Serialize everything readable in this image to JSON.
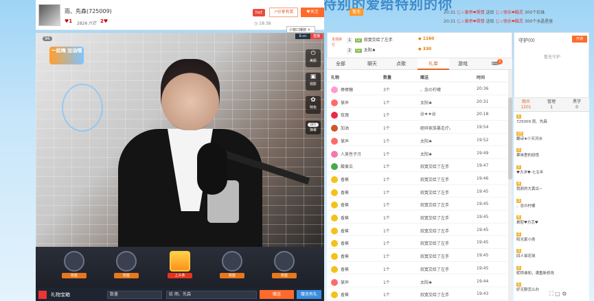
{
  "banner": "待别的爱给特别的你",
  "anchor": {
    "name": "雨、先森(725009)",
    "level_a": "1",
    "fans": "2826 六芒",
    "level_b": "2",
    "hot": "hot",
    "share": "分享有奖",
    "follow": "关注",
    "time_info": "18:38",
    "popup_tip": "小窗口播放",
    "logo_a": "6.cn",
    "logo_b": "直播",
    "rank_tag": "暂无"
  },
  "video": {
    "viewers": "96",
    "deco_text": "一起嗨 加油哦"
  },
  "video_tools": [
    {
      "icon": "power-icon",
      "label": "美颜"
    },
    {
      "icon": "photo-icon",
      "label": "观影"
    },
    {
      "icon": "filter-icon",
      "label": "特色"
    },
    {
      "icon": "barrage-toggle",
      "label": "弹幕",
      "toggle": "OFF"
    }
  ],
  "gift_slots": [
    "抢座",
    "抢座",
    "上头条",
    "抢座",
    "抢座"
  ],
  "bottom_bar": {
    "gift_box": "礼物宝箱",
    "qty_placeholder": "数量",
    "to_label": "给",
    "to_value": "雨、先森",
    "send": "赠送",
    "recharge": "赠充有礼"
  },
  "rank": {
    "title": "本场排行",
    "rows": [
      {
        "num": "1",
        "name": "寂寞交给了左手",
        "score": "1160"
      },
      {
        "num": "2",
        "name": "太阳♠",
        "score": "330"
      }
    ]
  },
  "notify": [
    {
      "time": "20:31",
      "user": "じ☆黄帝❤晋翡",
      "text": "送给",
      "to": "じ☆快乐❤酷灵",
      "item": "300个珍珠"
    },
    {
      "time": "20:31",
      "user": "じ☆黄帝❤晋翡",
      "text": "送给",
      "to": "じ☆快乐❤酷灵",
      "item": "300个水晶星座"
    }
  ],
  "tabs": [
    "全部",
    "聊天",
    "点歌",
    "礼单",
    "游戏"
  ],
  "tab_badge": "1",
  "gift_table": {
    "headers": [
      "礼物",
      "数量",
      "赠送",
      "时间"
    ],
    "rows": [
      {
        "gift": "棒棒糖",
        "qty": "3个",
        "from": "、念の柠檬",
        "time": "20:36",
        "color": "#ff9ad0"
      },
      {
        "gift": "掌声",
        "qty": "1个",
        "from": "太阳♠",
        "time": "20:31",
        "color": "#ff6a6a"
      },
      {
        "gift": "玫瑰",
        "qty": "1个",
        "from": "@★★@",
        "time": "20:18",
        "color": "#e82a4a"
      },
      {
        "gift": "加油",
        "qty": "1个",
        "from": "砸碎家族暴走疗。",
        "time": "19:54",
        "color": "#c85a2a"
      },
      {
        "gift": "掌声",
        "qty": "1个",
        "from": "太阳♠",
        "time": "19:52",
        "color": "#ff6a6a"
      },
      {
        "gift": "人美性子污",
        "qty": "1个",
        "from": "太阳♠",
        "time": "19:49",
        "color": "#f07ab0"
      },
      {
        "gift": "酸黄瓜",
        "qty": "1个",
        "from": "寂寞交给了左手",
        "time": "19:47",
        "color": "#4aa84a"
      },
      {
        "gift": "香蕉",
        "qty": "1个",
        "from": "寂寞交给了左手",
        "time": "19:46",
        "color": "#f2c21a"
      },
      {
        "gift": "香蕉",
        "qty": "1个",
        "from": "寂寞交给了左手",
        "time": "19:45",
        "color": "#f2c21a"
      },
      {
        "gift": "香蕉",
        "qty": "1个",
        "from": "寂寞交给了左手",
        "time": "19:45",
        "color": "#f2c21a"
      },
      {
        "gift": "香蕉",
        "qty": "1个",
        "from": "寂寞交给了左手",
        "time": "19:45",
        "color": "#f2c21a"
      },
      {
        "gift": "香蕉",
        "qty": "1个",
        "from": "寂寞交给了左手",
        "time": "19:45",
        "color": "#f2c21a"
      },
      {
        "gift": "香蕉",
        "qty": "1个",
        "from": "寂寞交给了左手",
        "time": "19:45",
        "color": "#f2c21a"
      },
      {
        "gift": "香蕉",
        "qty": "1个",
        "from": "寂寞交给了左手",
        "time": "19:45",
        "color": "#f2c21a"
      },
      {
        "gift": "香蕉",
        "qty": "1个",
        "from": "寂寞交给了左手",
        "time": "19:45",
        "color": "#f2c21a"
      },
      {
        "gift": "掌声",
        "qty": "1个",
        "from": "太阳♠",
        "time": "19:44",
        "color": "#ff6a6a"
      },
      {
        "gift": "香蕉",
        "qty": "1个",
        "from": "寂寞交给了左手",
        "time": "19:43",
        "color": "#f2c21a"
      }
    ]
  },
  "guard": {
    "title": "守护(0)",
    "open": "开通",
    "empty": "暂无守护"
  },
  "audience_tabs": [
    {
      "label": "观众",
      "count": "1201"
    },
    {
      "label": "管理",
      "count": "1"
    },
    {
      "label": "黑学",
      "count": "0"
    }
  ],
  "audience": [
    {
      "lvl": "1",
      "name": "725009 雨、先森"
    },
    {
      "lvl": "10",
      "name": "翻诗★少天河水"
    },
    {
      "lvl": "2",
      "name": "果味里的奴怪"
    },
    {
      "lvl": "5",
      "name": "♥大洋♥-七五年"
    },
    {
      "lvl": "4",
      "name": "我邪的大黄瓜~"
    },
    {
      "lvl": "3",
      "name": "、念の柠檬"
    },
    {
      "lvl": "6",
      "name": "裹腔♥方芯♥"
    },
    {
      "lvl": "2",
      "name": "阳光家小类"
    },
    {
      "lvl": "3",
      "name": "四人邹花球"
    },
    {
      "lvl": "2",
      "name": "昵称谁知，满重新修改"
    },
    {
      "lvl": "1",
      "name": "好无聊怎么办"
    }
  ]
}
